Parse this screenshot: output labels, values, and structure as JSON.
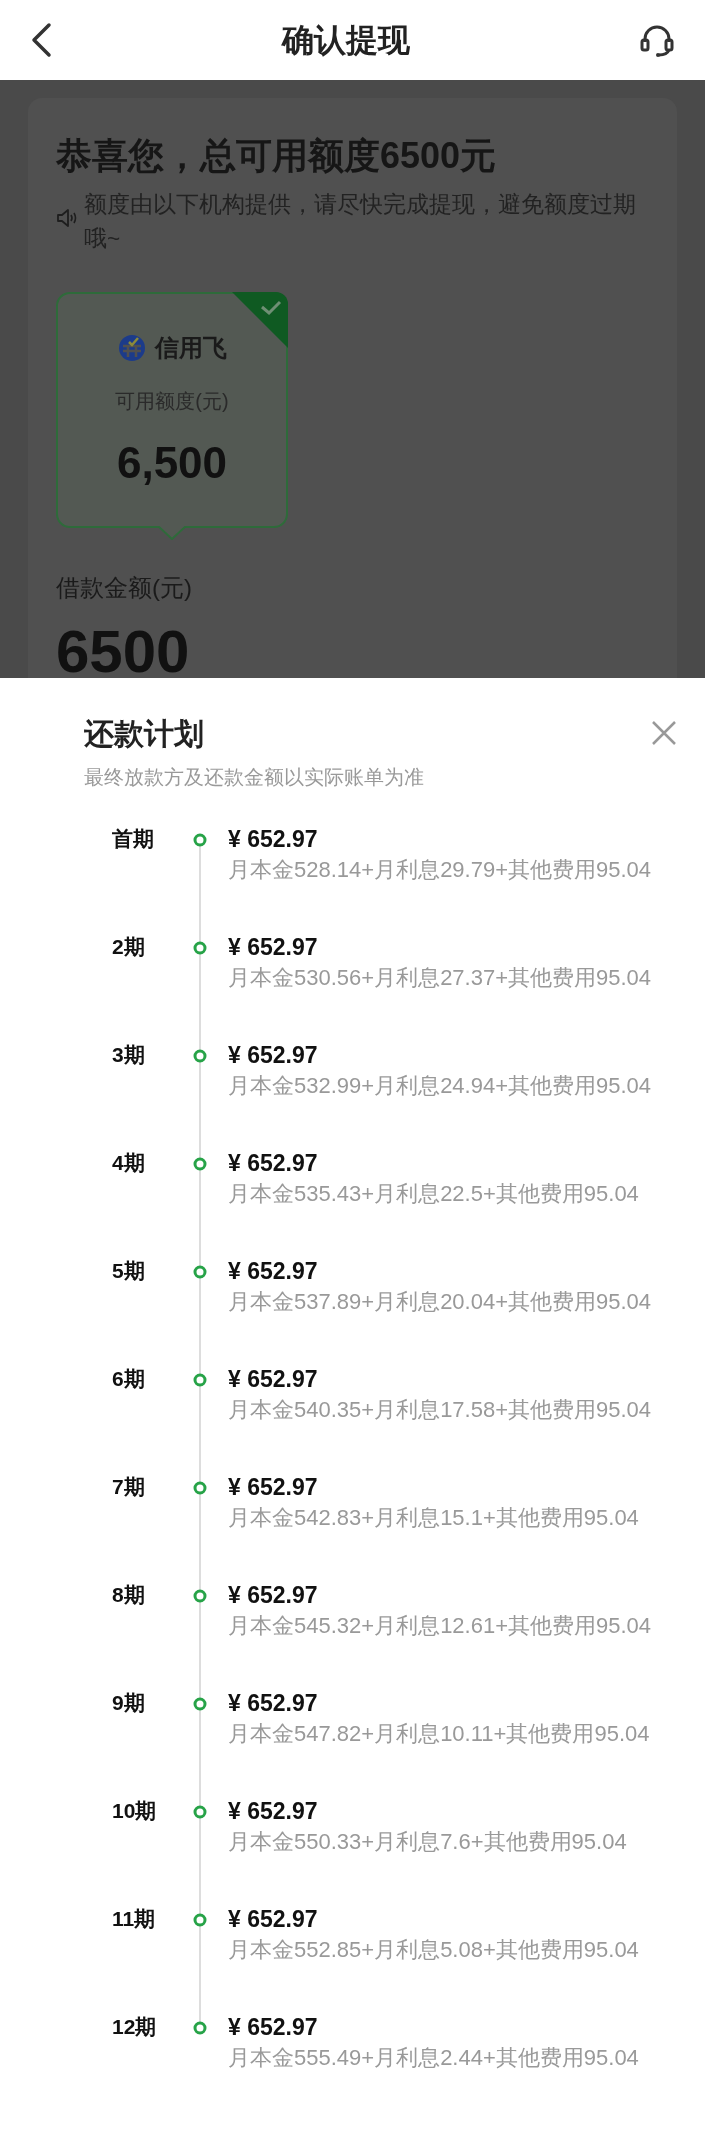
{
  "header": {
    "title": "确认提现"
  },
  "offer": {
    "heading": "恭喜您，总可用额度6500元",
    "notice": "额度由以下机构提供，请尽快完成提现，避免额度过期哦~",
    "lenders": [
      {
        "name": "信用飞",
        "label": "可用额度(元)",
        "amount": "6,500",
        "selected": true
      }
    ],
    "loan_label": "借款金额(元)",
    "loan_amount": "6500"
  },
  "plan": {
    "title": "还款计划",
    "subtitle": "最终放款方及还款金额以实际账单为准",
    "rows": [
      {
        "period": "首期",
        "amount": "¥ 652.97",
        "detail": "月本金528.14+月利息29.79+其他费用95.04"
      },
      {
        "period": "2期",
        "amount": "¥ 652.97",
        "detail": "月本金530.56+月利息27.37+其他费用95.04"
      },
      {
        "period": "3期",
        "amount": "¥ 652.97",
        "detail": "月本金532.99+月利息24.94+其他费用95.04"
      },
      {
        "period": "4期",
        "amount": "¥ 652.97",
        "detail": "月本金535.43+月利息22.5+其他费用95.04"
      },
      {
        "period": "5期",
        "amount": "¥ 652.97",
        "detail": "月本金537.89+月利息20.04+其他费用95.04"
      },
      {
        "period": "6期",
        "amount": "¥ 652.97",
        "detail": "月本金540.35+月利息17.58+其他费用95.04"
      },
      {
        "period": "7期",
        "amount": "¥ 652.97",
        "detail": "月本金542.83+月利息15.1+其他费用95.04"
      },
      {
        "period": "8期",
        "amount": "¥ 652.97",
        "detail": "月本金545.32+月利息12.61+其他费用95.04"
      },
      {
        "period": "9期",
        "amount": "¥ 652.97",
        "detail": "月本金547.82+月利息10.11+其他费用95.04"
      },
      {
        "period": "10期",
        "amount": "¥ 652.97",
        "detail": "月本金550.33+月利息7.6+其他费用95.04"
      },
      {
        "period": "11期",
        "amount": "¥ 652.97",
        "detail": "月本金552.85+月利息5.08+其他费用95.04"
      },
      {
        "period": "12期",
        "amount": "¥ 652.97",
        "detail": "月本金555.49+月利息2.44+其他费用95.04"
      }
    ]
  }
}
